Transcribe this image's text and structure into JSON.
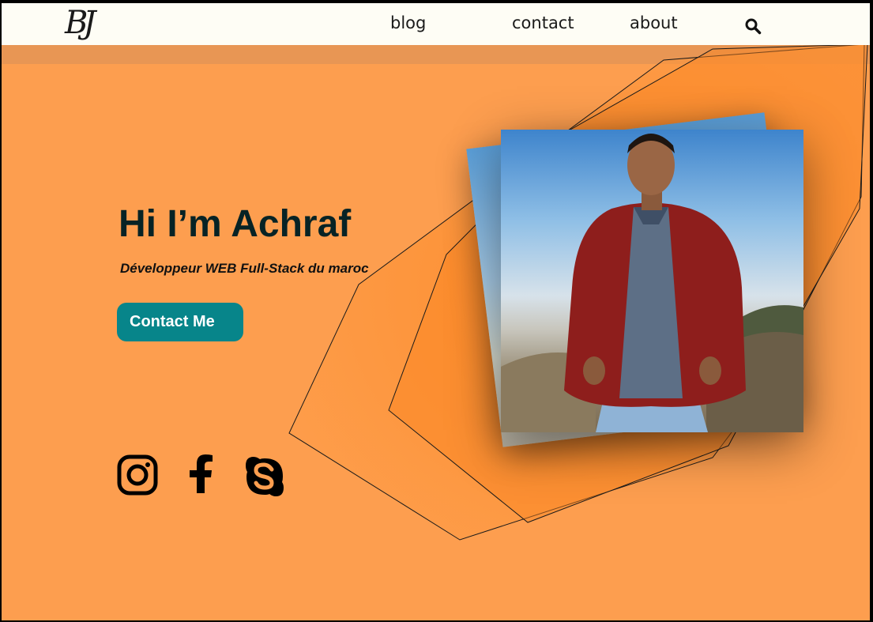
{
  "logo": {
    "text": "BJ"
  },
  "nav": {
    "links": [
      {
        "label": "blog"
      },
      {
        "label": "contact"
      },
      {
        "label": "about"
      }
    ],
    "search_icon": "search-icon"
  },
  "hero": {
    "title": "Hi I’m Achraf",
    "subtitle": "Développeur WEB Full-Stack  du maroc",
    "cta_label": "Contact Me"
  },
  "social": [
    "instagram-icon",
    "facebook-icon",
    "skype-icon"
  ],
  "colors": {
    "background": "#fd9e4f",
    "navbar": "#fefdf5",
    "accent_orange": "#fb8421",
    "button": "#07858a",
    "title": "#072325"
  }
}
